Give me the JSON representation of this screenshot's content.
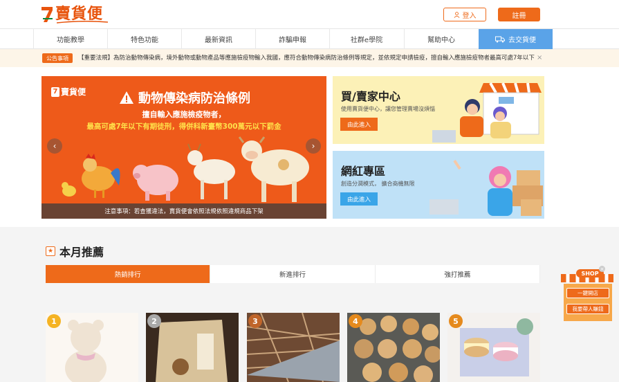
{
  "header": {
    "logo_text": "賣貨便",
    "login_label": "登入",
    "register_label": "註冊"
  },
  "nav": {
    "items": [
      "功能教學",
      "特色功能",
      "最新資訊",
      "詐騙申報",
      "社群e學院",
      "幫助中心"
    ],
    "ship_label": "去交貨便"
  },
  "announcement": {
    "tag": "公告事項",
    "text": "【重要法規】為防治動物傳染病，境外動物或動物產品等應施檢疫物輸入我國，應符合動物傳染病防治條例等規定，並依規定申請檢疫，擅自輸入應施檢疫物者最高可處7年以下"
  },
  "banner": {
    "logo": "賣貨便",
    "title": "動物傳染病防治條例",
    "line1": "擅自輸入應施檢疫物者，",
    "line2": "最高可處7年以下有期徒刑，得併科新臺幣300萬元以下罰金",
    "note": "注意事項：若查獲違法，賣貨便會依照法規依照違規商品下架",
    "prev": "‹",
    "next": "›"
  },
  "cards": {
    "buyer": {
      "title": "買/賣家中心",
      "desc": "使用賣貨便中心，讓您管理賣場沒煩惱",
      "button": "由此進入"
    },
    "influencer": {
      "title": "網紅專區",
      "desc": "創造分潤模式，  擴合商機無限",
      "button": "由此進入"
    }
  },
  "recommend": {
    "title": "本月推薦",
    "icon": "★",
    "tabs": [
      "熱銷排行",
      "新進排行",
      "強打推薦"
    ],
    "products": [
      {
        "rank": "1",
        "badge_color": "#f5b323",
        "icon": "teddy-bear-icon"
      },
      {
        "rank": "2",
        "badge_color": "#a9a9a9",
        "icon": "snack-bag-icon"
      },
      {
        "rank": "3",
        "badge_color": "#c0652a",
        "icon": "dried-fish-icon"
      },
      {
        "rank": "4",
        "badge_color": "#e58a1d",
        "icon": "bagel-icon"
      },
      {
        "rank": "5",
        "badge_color": "#e58a1d",
        "icon": "macaron-icon"
      }
    ]
  },
  "floating_shop": {
    "label": "SHOP",
    "button1": "一鍵開店",
    "button2": "我要帶人賺錢",
    "close": "×"
  },
  "colors": {
    "accent": "#ee6a1a",
    "ship_blue": "#5aa3e8",
    "buyer_bg": "#fcf1b7",
    "influencer_bg": "#bfe1f7"
  }
}
